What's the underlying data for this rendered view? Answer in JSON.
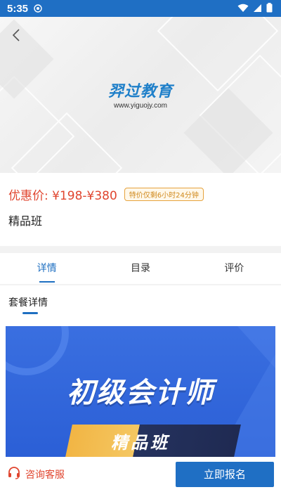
{
  "status_bar": {
    "time": "5:35"
  },
  "hero": {
    "brand_name": "羿过教育",
    "brand_url": "www.yiguojy.com"
  },
  "product": {
    "price_label": "优惠价: ¥198-¥380",
    "countdown_badge": "特价仅剩6小时24分钟",
    "name": "精品班"
  },
  "tabs": [
    {
      "label": "详情",
      "active": true
    },
    {
      "label": "目录",
      "active": false
    },
    {
      "label": "评价",
      "active": false
    }
  ],
  "section": {
    "title": "套餐详情"
  },
  "promo": {
    "title": "初级会计师",
    "subtitle": "精品班"
  },
  "bottom_bar": {
    "service_label": "咨询客服",
    "enroll_label": "立即报名"
  },
  "colors": {
    "primary": "#1f6fc4",
    "price": "#e0452f",
    "badge": "#e6a23c"
  }
}
